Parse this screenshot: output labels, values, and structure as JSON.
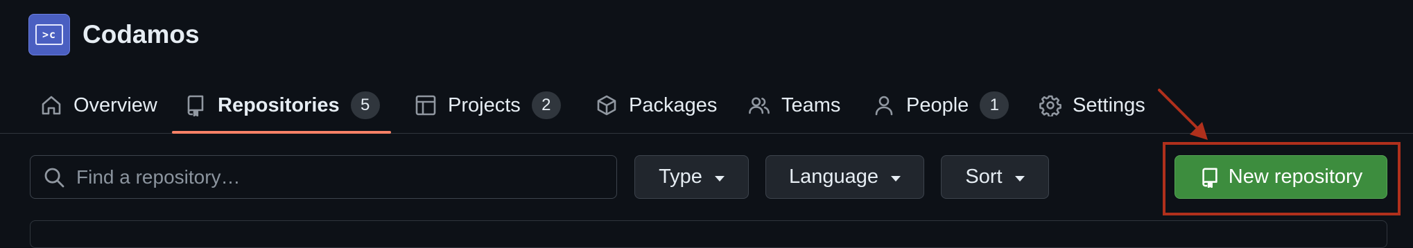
{
  "org": {
    "name": "Codamos",
    "avatar_text": ">c"
  },
  "nav": {
    "items": [
      {
        "label": "Overview",
        "icon": "home-icon"
      },
      {
        "label": "Repositories",
        "icon": "repo-icon",
        "count": "5",
        "active": true
      },
      {
        "label": "Projects",
        "icon": "table-icon",
        "count": "2"
      },
      {
        "label": "Packages",
        "icon": "package-icon"
      },
      {
        "label": "Teams",
        "icon": "people-icon"
      },
      {
        "label": "People",
        "icon": "person-icon",
        "count": "1"
      },
      {
        "label": "Settings",
        "icon": "gear-icon"
      }
    ]
  },
  "toolbar": {
    "search_placeholder": "Find a repository…",
    "type_label": "Type",
    "language_label": "Language",
    "sort_label": "Sort",
    "new_repo_label": "New repository"
  },
  "colors": {
    "background": "#0d1117",
    "active_tab_underline": "#f78166",
    "primary_button": "#3d8d3e",
    "annotation": "#b0301c"
  }
}
